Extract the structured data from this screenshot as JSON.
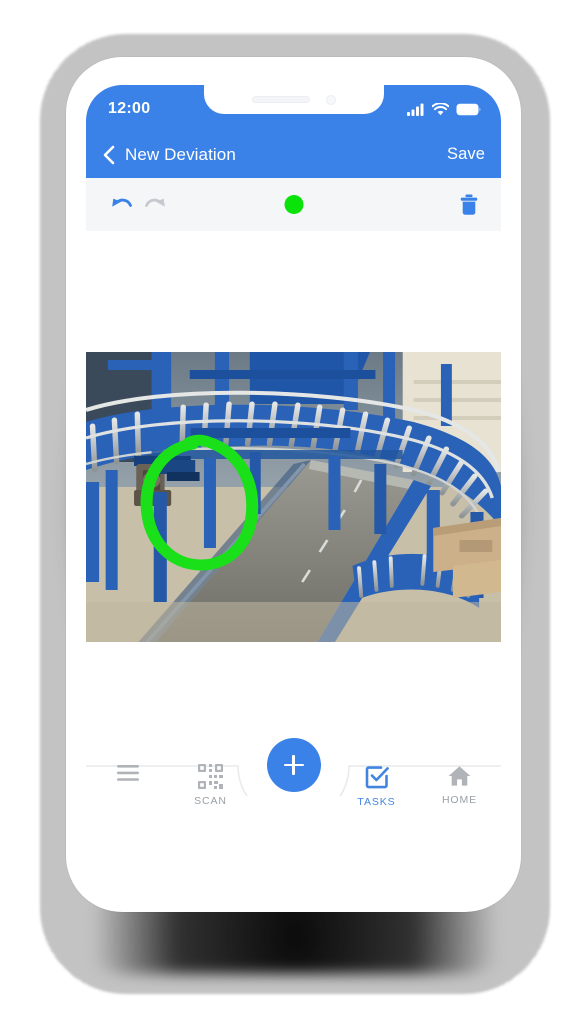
{
  "device": {
    "status_bar": {
      "time": "12:00",
      "icons": [
        "signal-icon",
        "wifi-icon",
        "battery-icon"
      ]
    },
    "notch": {
      "speaker": "speaker-slot",
      "camera": "front-camera"
    }
  },
  "header": {
    "back_icon": "chevron-left-icon",
    "title": "New Deviation",
    "save_label": "Save",
    "background_color": "#3b82e8"
  },
  "edit_toolbar": {
    "undo": {
      "icon": "undo-icon",
      "enabled": true,
      "color": "#3b82e8"
    },
    "redo": {
      "icon": "redo-icon",
      "enabled": false,
      "color": "#c6cace"
    },
    "color_swatch": {
      "icon": "color-dot",
      "color": "#09e309"
    },
    "delete": {
      "icon": "trash-icon",
      "color": "#3b82e8"
    },
    "background_color": "#f5f6f8"
  },
  "canvas": {
    "photo": {
      "alt": "industrial blue roller conveyor system",
      "annotation": {
        "shape": "freehand-circle",
        "color": "#19e019"
      }
    }
  },
  "bottom_nav": {
    "items": [
      {
        "icon": "hamburger-menu-icon",
        "label": "",
        "active": false
      },
      {
        "icon": "qr-scan-icon",
        "label": "SCAN",
        "active": false
      },
      {
        "icon": "checkbox-tasks-icon",
        "label": "TASKS",
        "active": true
      },
      {
        "icon": "home-icon",
        "label": "HOME",
        "active": false
      }
    ],
    "fab": {
      "icon": "plus-icon",
      "color": "#3b82e8"
    },
    "active_color": "#4285e0",
    "inactive_color": "#9aa0a6"
  }
}
